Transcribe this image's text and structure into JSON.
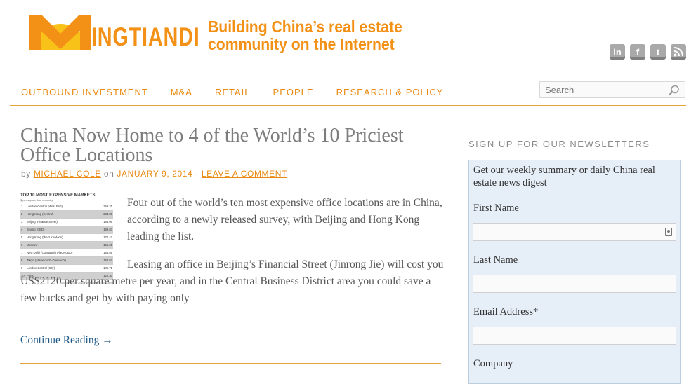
{
  "header": {
    "logo_text": "INGTIANDI",
    "tagline_line1": "Building China’s real estate",
    "tagline_line2": "community on the Internet",
    "social_icons": [
      "linkedin-icon",
      "facebook-icon",
      "twitter-icon",
      "rss-icon"
    ]
  },
  "nav": {
    "items": [
      "OUTBOUND INVESTMENT",
      "M&A",
      "RETAIL",
      "PEOPLE",
      "RESEARCH & POLICY"
    ],
    "search_placeholder": "Search"
  },
  "post": {
    "title": "China Now Home to 4 of the World’s 10 Priciest Office Locations",
    "meta_by": "by",
    "author": "MICHAEL COLE",
    "meta_on": "on",
    "date": "JANUARY 9, 2014",
    "meta_sep": "·",
    "comment_link": "LEAVE A COMMENT",
    "paragraph1": "Four out of the world’s ten most expensive office locations are in China, according to a newly released survey, with Beijing and Hong Kong leading the list.",
    "paragraph2": "Leasing an office in Beijing’s Financial Street (Jinrong Jie) will cost you US$2120 per square metre per year, and in the Central Business District area you could save a few bucks and get by with paying only",
    "continue": "Continue Reading →",
    "thumb": {
      "title": "TOP 10 MOST EXPENSIVE MARKETS",
      "subtitle": "$ per square foot annually",
      "rows": [
        {
          "rank": "1",
          "name": "London-Central (West End)",
          "value": "259.31"
        },
        {
          "rank": "2",
          "name": "Hong Kong (Central)",
          "value": "234.36"
        },
        {
          "rank": "3",
          "name": "Beijing (Finance Street)",
          "value": "183.06"
        },
        {
          "rank": "4",
          "name": "Beijing (CBD)",
          "value": "189.67"
        },
        {
          "rank": "5",
          "name": "Hong Kong (West Kowloon)",
          "value": "170.42"
        },
        {
          "rank": "6",
          "name": "Moscow",
          "value": "165.05"
        },
        {
          "rank": "7",
          "name": "New Delhi (Connaught Place-CBD)",
          "value": "156.65"
        },
        {
          "rank": "8",
          "name": "Tokyo (Marunouchi Otemachi)",
          "value": "154.67"
        },
        {
          "rank": "9",
          "name": "London-Central (City)",
          "value": "142.71"
        },
        {
          "rank": "10",
          "name": "Paris",
          "value": "122.30"
        }
      ],
      "source": "Source: CBRE Global Research and Consulting"
    }
  },
  "sidebar": {
    "title": "SIGN UP FOR OUR NEWSLETTERS",
    "description": "Get our weekly summary or daily China real estate news digest",
    "first_name_label": "First Name",
    "last_name_label": "Last Name",
    "email_label": "Email Address*",
    "company_label": "Company"
  },
  "colors": {
    "brand_orange": "#f39117",
    "nav_orange": "#e98a12",
    "link_blue": "#1e5886",
    "newsletter_bg": "#e6eef8"
  }
}
